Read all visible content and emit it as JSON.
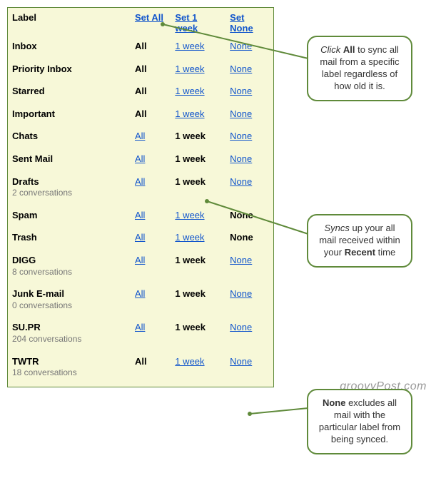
{
  "header": {
    "label": "Label",
    "set_all": "Set All",
    "set_week": "Set 1 week",
    "set_none": "Set None"
  },
  "opts": {
    "all": "All",
    "week": "1 week",
    "none": "None"
  },
  "rows": [
    {
      "name": "Inbox",
      "sub": "",
      "sel": "all"
    },
    {
      "name": "Priority Inbox",
      "sub": "",
      "sel": "all"
    },
    {
      "name": "Starred",
      "sub": "",
      "sel": "all"
    },
    {
      "name": "Important",
      "sub": "",
      "sel": "all"
    },
    {
      "name": "Chats",
      "sub": "",
      "sel": "week"
    },
    {
      "name": "Sent Mail",
      "sub": "",
      "sel": "week"
    },
    {
      "name": "Drafts",
      "sub": "2 conversations",
      "sel": "week"
    },
    {
      "name": "Spam",
      "sub": "",
      "sel": "none"
    },
    {
      "name": "Trash",
      "sub": "",
      "sel": "none"
    },
    {
      "name": "DIGG",
      "sub": "8 conversations",
      "sel": "week"
    },
    {
      "name": "Junk E-mail",
      "sub": "0 conversations",
      "sel": "week"
    },
    {
      "name": "SU.PR",
      "sub": "204 conversations",
      "sel": "week"
    },
    {
      "name": "TWTR",
      "sub": "18 conversations",
      "sel": "all"
    }
  ],
  "callouts": {
    "all": {
      "pre": "Click ",
      "bold": "All",
      "post": " to sync all mail from a specific label regardless of how old it is."
    },
    "week": {
      "pre": "Syncs",
      "mid": " up your all mail received within your ",
      "bold": "Recent",
      "post": " time"
    },
    "none": {
      "bold": "None",
      "post": " excludes all mail with the particular label from being synced."
    }
  },
  "watermark": "groovyPost.com"
}
